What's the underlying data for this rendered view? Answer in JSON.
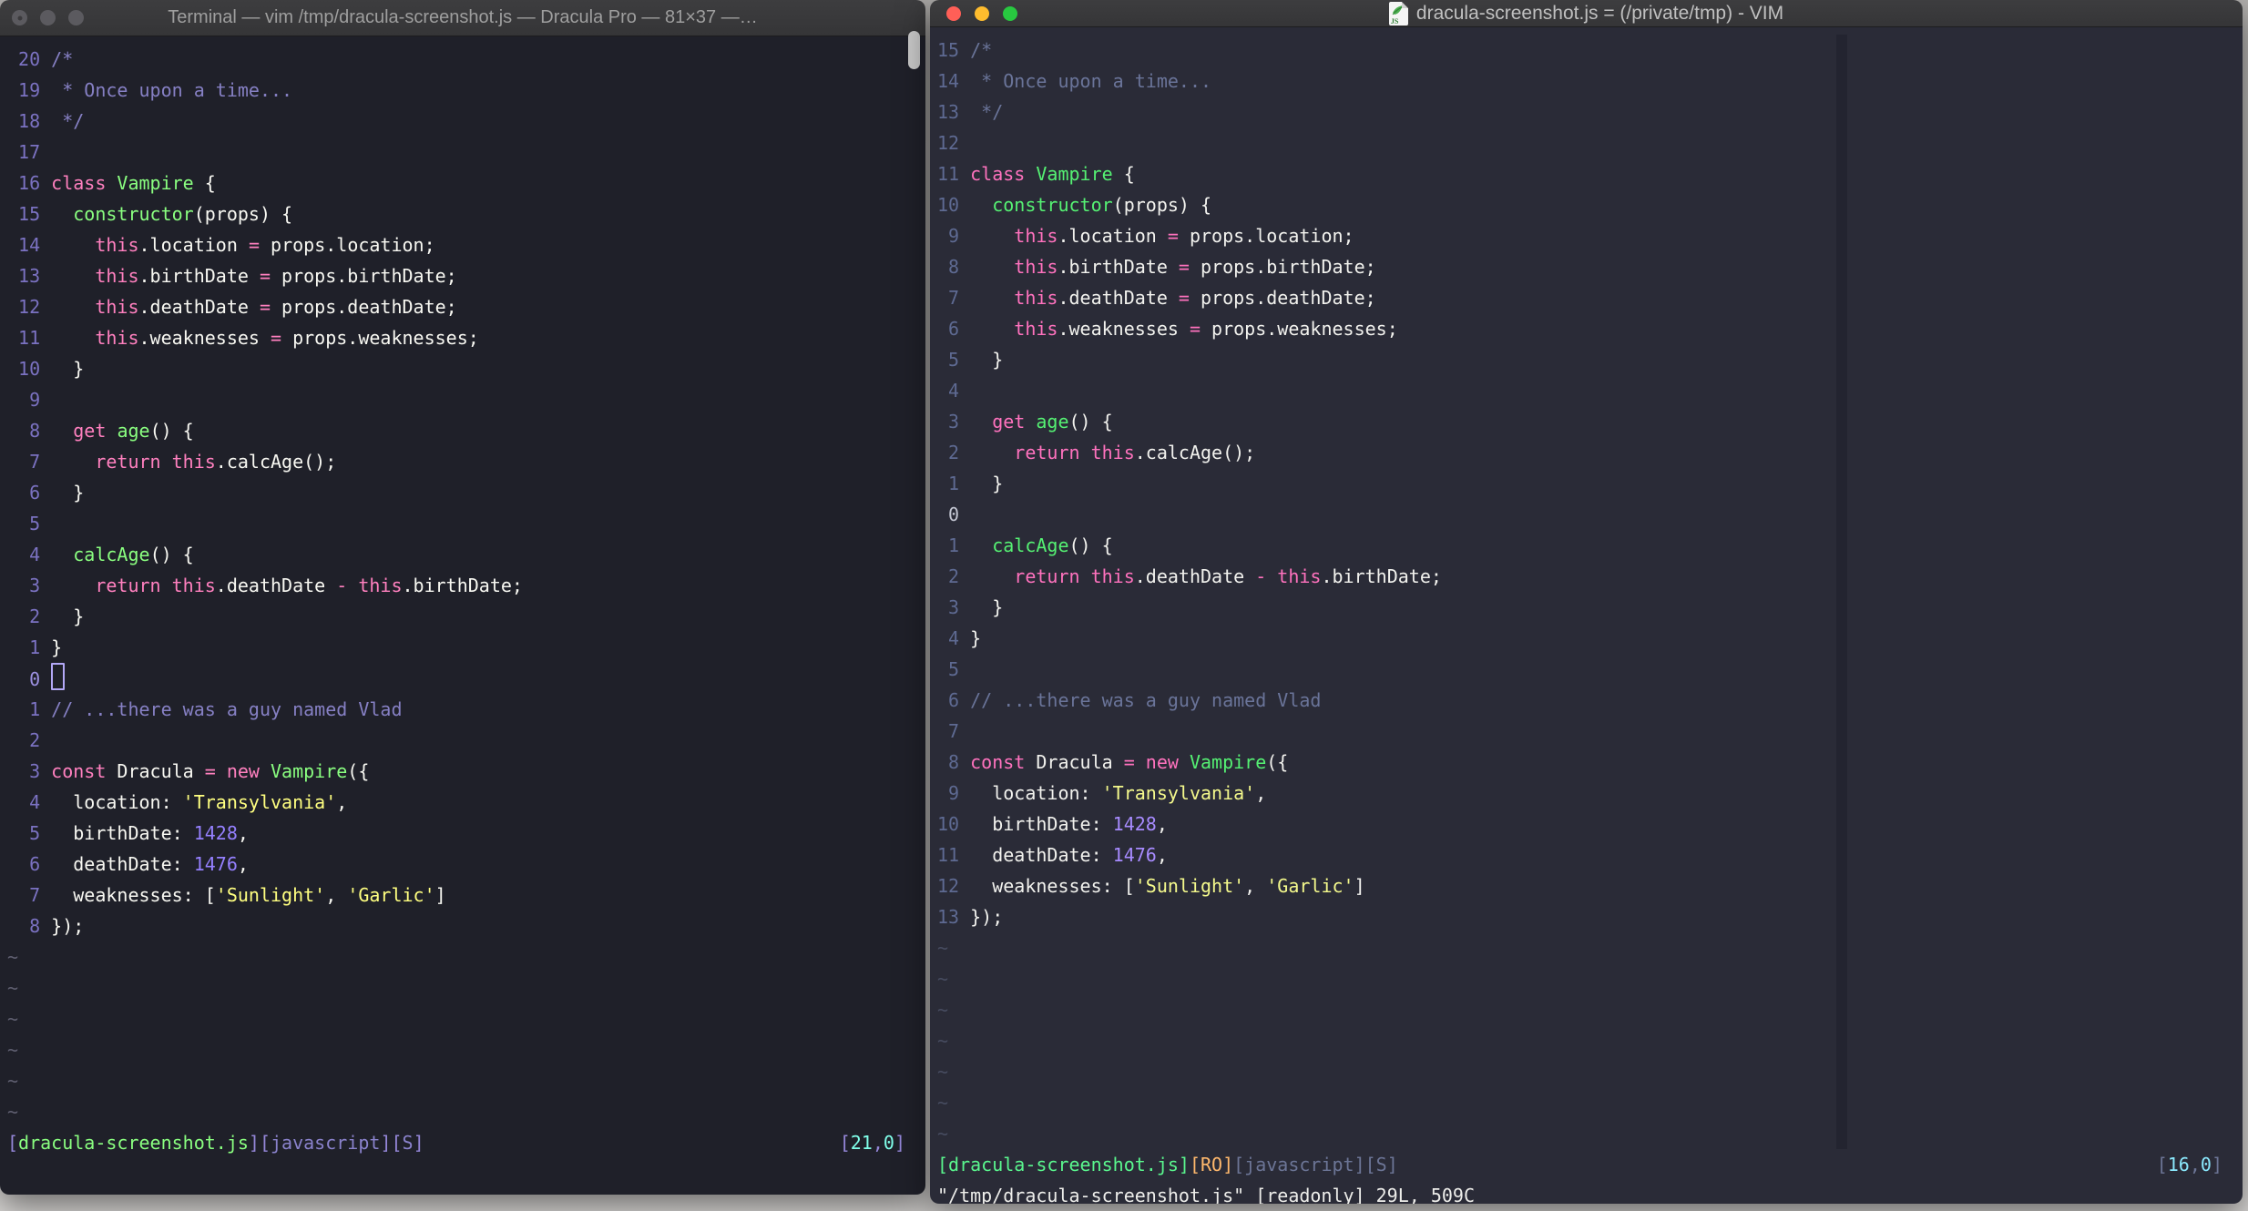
{
  "desktop": {
    "background_top": "#b3b1af",
    "background_bottom": "#d8d6d4"
  },
  "traffic_lights": {
    "inactive": "#5b5a5f",
    "red": "#ff5f57",
    "yellow": "#febc2e",
    "green": "#28c840"
  },
  "code_lines": [
    {
      "segs": [
        [
          "c",
          "/*"
        ]
      ]
    },
    {
      "segs": [
        [
          "c",
          " * Once upon a time..."
        ]
      ]
    },
    {
      "segs": [
        [
          "c",
          " */"
        ]
      ]
    },
    {
      "segs": []
    },
    {
      "segs": [
        [
          "p",
          "class "
        ],
        [
          "g",
          "Vampire "
        ],
        [
          "f",
          "{"
        ]
      ]
    },
    {
      "segs": [
        [
          "f",
          "  "
        ],
        [
          "g",
          "constructor"
        ],
        [
          "f",
          "(props) {"
        ]
      ]
    },
    {
      "segs": [
        [
          "f",
          "    "
        ],
        [
          "p",
          "this"
        ],
        [
          "f",
          ".location "
        ],
        [
          "p",
          "="
        ],
        [
          "f",
          " props.location;"
        ]
      ]
    },
    {
      "segs": [
        [
          "f",
          "    "
        ],
        [
          "p",
          "this"
        ],
        [
          "f",
          ".birthDate "
        ],
        [
          "p",
          "="
        ],
        [
          "f",
          " props.birthDate;"
        ]
      ]
    },
    {
      "segs": [
        [
          "f",
          "    "
        ],
        [
          "p",
          "this"
        ],
        [
          "f",
          ".deathDate "
        ],
        [
          "p",
          "="
        ],
        [
          "f",
          " props.deathDate;"
        ]
      ]
    },
    {
      "segs": [
        [
          "f",
          "    "
        ],
        [
          "p",
          "this"
        ],
        [
          "f",
          ".weaknesses "
        ],
        [
          "p",
          "="
        ],
        [
          "f",
          " props.weaknesses;"
        ]
      ]
    },
    {
      "segs": [
        [
          "f",
          "  }"
        ]
      ]
    },
    {
      "segs": []
    },
    {
      "segs": [
        [
          "f",
          "  "
        ],
        [
          "p",
          "get "
        ],
        [
          "g",
          "age"
        ],
        [
          "f",
          "() {"
        ]
      ]
    },
    {
      "segs": [
        [
          "f",
          "    "
        ],
        [
          "p",
          "return this"
        ],
        [
          "f",
          ".calcAge();"
        ]
      ]
    },
    {
      "segs": [
        [
          "f",
          "  }"
        ]
      ]
    },
    {
      "segs": []
    },
    {
      "segs": [
        [
          "f",
          "  "
        ],
        [
          "g",
          "calcAge"
        ],
        [
          "f",
          "() {"
        ]
      ]
    },
    {
      "segs": [
        [
          "f",
          "    "
        ],
        [
          "p",
          "return this"
        ],
        [
          "f",
          ".deathDate "
        ],
        [
          "p",
          "-"
        ],
        [
          "f",
          " "
        ],
        [
          "p",
          "this"
        ],
        [
          "f",
          ".birthDate;"
        ]
      ]
    },
    {
      "segs": [
        [
          "f",
          "  }"
        ]
      ]
    },
    {
      "segs": [
        [
          "f",
          "}"
        ]
      ]
    },
    {
      "segs": []
    },
    {
      "segs": [
        [
          "c",
          "// ...there was a guy named Vlad"
        ]
      ]
    },
    {
      "segs": []
    },
    {
      "segs": [
        [
          "p",
          "const "
        ],
        [
          "f",
          "Dracula "
        ],
        [
          "p",
          "= new "
        ],
        [
          "g",
          "Vampire"
        ],
        [
          "f",
          "({"
        ]
      ]
    },
    {
      "segs": [
        [
          "f",
          "  location: "
        ],
        [
          "y",
          "'Transylvania'"
        ],
        [
          "f",
          ","
        ]
      ]
    },
    {
      "segs": [
        [
          "f",
          "  birthDate: "
        ],
        [
          "u",
          "1428"
        ],
        [
          "f",
          ","
        ]
      ]
    },
    {
      "segs": [
        [
          "f",
          "  deathDate: "
        ],
        [
          "u",
          "1476"
        ],
        [
          "f",
          ","
        ]
      ]
    },
    {
      "segs": [
        [
          "f",
          "  weaknesses: ["
        ],
        [
          "y",
          "'Sunlight'"
        ],
        [
          "f",
          ", "
        ],
        [
          "y",
          "'Garlic'"
        ],
        [
          "f",
          "]"
        ]
      ]
    },
    {
      "segs": [
        [
          "f",
          "});"
        ]
      ]
    }
  ],
  "left_window": {
    "title": "Terminal — vim /tmp/dracula-screenshot.js — Dracula Pro — 81×37 —…",
    "title_color": "#9e9e9e",
    "active": false,
    "gutters": [
      "20",
      "19",
      "18",
      "17",
      "16",
      "15",
      "14",
      "13",
      "12",
      "11",
      "10",
      "9",
      "8",
      "7",
      "6",
      "5",
      "4",
      "3",
      "2",
      "1",
      "0",
      "1",
      "2",
      "3",
      "4",
      "5",
      "6",
      "7",
      "8"
    ],
    "cursor_row": 20,
    "cursor_style": "hollow-block",
    "gutter_width": 3,
    "tilde_count": 6,
    "status_left": [
      [
        "bracket",
        "["
      ],
      [
        "filename",
        "dracula-screenshot.js"
      ],
      [
        "bracket",
        "]["
      ],
      [
        "filetype",
        "javascript"
      ],
      [
        "bracket",
        "]["
      ],
      [
        "filetype",
        "S"
      ],
      [
        "bracket",
        "]"
      ]
    ],
    "status_right": [
      [
        "bracket",
        "["
      ],
      [
        "position",
        "21"
      ],
      [
        "bracket",
        ","
      ],
      [
        "position",
        "0"
      ],
      [
        "bracket",
        "]"
      ]
    ],
    "command_line": "",
    "palette": {
      "bg": "#1f2029",
      "fg": "#f8f8f2",
      "c": "#8680c4",
      "p": "#ff80bf",
      "g": "#8aff80",
      "f": "#f8f8f2",
      "y": "#ffff80",
      "u": "#9580ff",
      "linenr": "#7b72c2",
      "cursor_linenr": "#9d91e2",
      "tilde": "#5f5f70",
      "bracket": "#9486d8",
      "filename": "#8aff80",
      "filetype": "#8a82cc",
      "position": "#80ffea",
      "ro": "#ffb86c",
      "command": "#f8f8f2"
    }
  },
  "right_window": {
    "title": "dracula-screenshot.js = (/private/tmp) - VIM",
    "title_color": "#c0c0c0",
    "active": true,
    "file_icon": "js-file-icon",
    "gutters": [
      "15",
      "14",
      "13",
      "12",
      "11",
      "10",
      "9",
      "8",
      "7",
      "6",
      "5",
      "4",
      "3",
      "2",
      "1",
      "0",
      "1",
      "2",
      "3",
      "4",
      "5",
      "6",
      "7",
      "8",
      "9",
      "10",
      "11",
      "12",
      "13"
    ],
    "cursor_row": 15,
    "cursor_style": "none-visible",
    "gutter_width": 2,
    "tilde_count": 7,
    "status_left": [
      [
        "filename",
        "[dracula-screenshot.js]"
      ],
      [
        "ro",
        "[RO]"
      ],
      [
        "filetype",
        "[javascript][S]"
      ]
    ],
    "status_right": [
      [
        "bracket",
        "["
      ],
      [
        "position",
        "16"
      ],
      [
        "bracket",
        ","
      ],
      [
        "position",
        "0"
      ],
      [
        "bracket",
        "]"
      ]
    ],
    "command_line": "\"/tmp/dracula-screenshot.js\" [readonly] 29L, 509C",
    "colorcolumn": true,
    "palette": {
      "bg": "#2a2b37",
      "fg": "#f2f2ee",
      "c": "#6a7499",
      "p": "#ff72be",
      "g": "#55f173",
      "f": "#f2f2ee",
      "y": "#f4f98c",
      "u": "#a78bff",
      "linenr": "#5e6a92",
      "cursor_linenr": "#c3c6d2",
      "tilde": "#474c60",
      "bracket": "#6c7596",
      "filename": "#5af78e",
      "filetype": "#6c7596",
      "position": "#8be9fd",
      "ro": "#ffb86c",
      "command": "#ededea",
      "colorcolumn": "#232430"
    }
  }
}
